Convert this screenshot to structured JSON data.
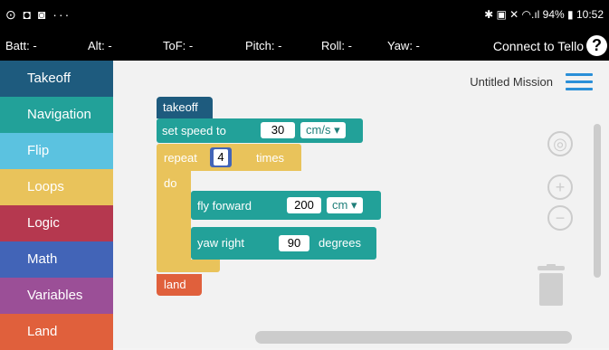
{
  "statusbar": {
    "left_icons": "⊙ ◘ ◙ ···",
    "right_text": "✱ ▣ ✕ ◠.ıl 94% ▮ 10:52"
  },
  "telemetry": {
    "batt": "Batt: -",
    "alt": "Alt: -",
    "tof": "ToF: -",
    "pitch": "Pitch: -",
    "roll": "Roll: -",
    "yaw": "Yaw: -",
    "connect_label": "Connect to Tello",
    "help_label": "?"
  },
  "sidebar": {
    "items": [
      {
        "label": "Takeoff",
        "color": "#1e5b7e"
      },
      {
        "label": "Navigation",
        "color": "#22a199"
      },
      {
        "label": "Flip",
        "color": "#5bc2e0"
      },
      {
        "label": "Loops",
        "color": "#e9c35b"
      },
      {
        "label": "Logic",
        "color": "#b5384f"
      },
      {
        "label": "Math",
        "color": "#4264b7"
      },
      {
        "label": "Variables",
        "color": "#9b4f97"
      },
      {
        "label": "Land",
        "color": "#e0603c"
      }
    ]
  },
  "workspace": {
    "mission_title": "Untitled Mission",
    "blocks": {
      "takeoff": "takeoff",
      "set_speed": "set speed to",
      "speed_value": "30",
      "speed_unit": "cm/s",
      "repeat": "repeat",
      "repeat_count": "4",
      "times": "times",
      "do": "do",
      "fly_forward": "fly forward",
      "distance_value": "200",
      "distance_unit": "cm",
      "yaw_right": "yaw right",
      "yaw_value": "90",
      "degrees": "degrees",
      "land": "land"
    }
  },
  "icons": {
    "recenter": "target-icon",
    "zoom_in": "plus-icon",
    "zoom_out": "minus-icon",
    "trash": "trash-icon",
    "menu": "hamburger-icon"
  }
}
